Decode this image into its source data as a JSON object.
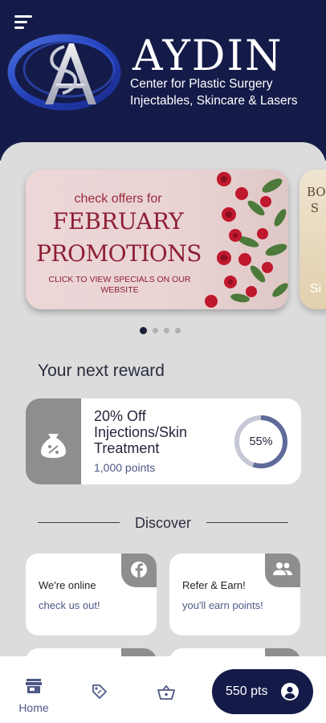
{
  "header": {
    "brand_name": "AYDIN",
    "brand_line1": "Center for Plastic Surgery",
    "brand_line2": "Injectables, Skincare & Lasers",
    "menu_icon": "hamburger-menu-icon",
    "background": "#141b48"
  },
  "carousel": {
    "slides": [
      {
        "line1": "check offers for",
        "line2": "FEBRUARY",
        "line3": "PROMOTIONS",
        "line4": "CLICK TO VIEW SPECIALS ON OUR WEBSITE"
      },
      {
        "line1": "BO",
        "line2": "S",
        "line3": "Si"
      }
    ],
    "active_index": 0,
    "dot_count": 4
  },
  "reward": {
    "section_title": "Your next reward",
    "name": "20% Off Injections/Skin Treatment",
    "points": "1,000 points",
    "progress": 0.55,
    "progress_label": "55%",
    "icon": "money-bag-percent-icon"
  },
  "discover": {
    "label": "Discover",
    "tiles": [
      {
        "title": "We're online",
        "subtitle": "check us out!",
        "icon": "facebook-icon"
      },
      {
        "title": "Refer & Earn!",
        "subtitle": "you'll earn points!",
        "icon": "people-icon"
      }
    ]
  },
  "bottom_nav": {
    "home_label": "Home",
    "points_label": "550 pts",
    "items": [
      "home-icon",
      "tag-icon",
      "basket-icon",
      "account-icon"
    ]
  },
  "colors": {
    "navy": "#141b48",
    "panel": "#dcdcdd",
    "muted_blue": "#4d5886",
    "promo_red": "#8e1f33"
  }
}
